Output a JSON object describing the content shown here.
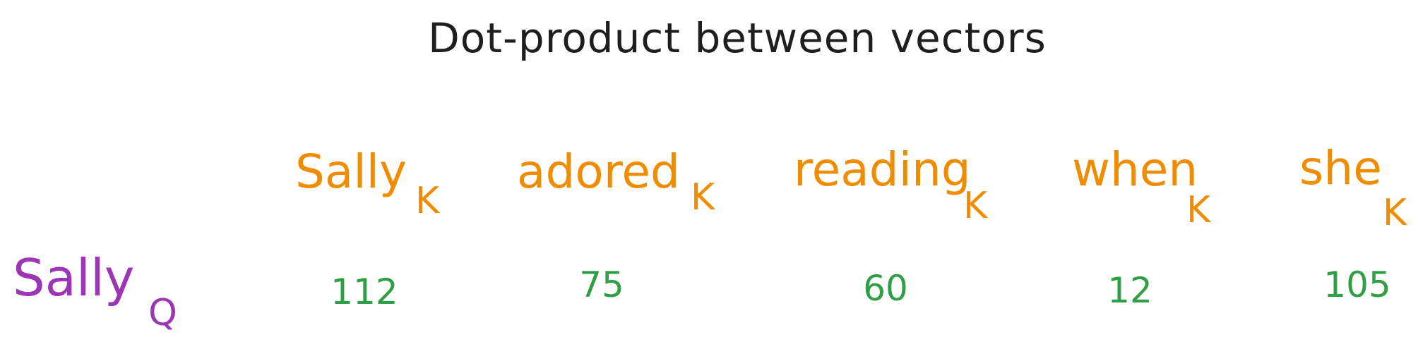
{
  "title": "Dot-product between vectors",
  "colors": {
    "title": "#1e1e1e",
    "key": "#f08c00",
    "query": "#9c36b5",
    "score": "#2f9e44"
  },
  "keys": [
    {
      "word": "Sally",
      "subscript": "K"
    },
    {
      "word": "adored",
      "subscript": "K"
    },
    {
      "word": "reading",
      "subscript": "K"
    },
    {
      "word": "when",
      "subscript": "K"
    },
    {
      "word": "she",
      "subscript": "K"
    }
  ],
  "query": {
    "word": "Sally",
    "subscript": "Q"
  },
  "scores": [
    "112",
    "75",
    "60",
    "12",
    "105"
  ]
}
